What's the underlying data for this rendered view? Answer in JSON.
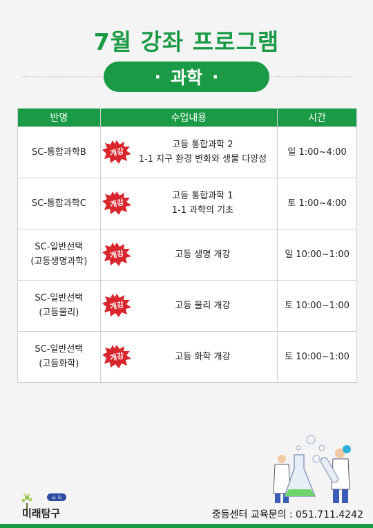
{
  "header": {
    "title": "7월 강좌 프로그램",
    "subject_dot_left": "·",
    "subject": "과학",
    "subject_dot_right": "·"
  },
  "table": {
    "headers": [
      "반명",
      "수업내용",
      "시간"
    ],
    "badge_text": "개강",
    "rows": [
      {
        "class_line1": "SC-통합과학B",
        "class_line2": "",
        "content_line1": "고등 통합과학 2",
        "content_line2": "1-1 지구 환경 변화와 생물 다양성",
        "time": "일 1:00~4:00"
      },
      {
        "class_line1": "SC-통합과학C",
        "class_line2": "",
        "content_line1": "고등 통합과학 1",
        "content_line2": "1-1 과학의 기초",
        "time": "토 1:00~4:00"
      },
      {
        "class_line1": "SC-일반선택",
        "class_line2": "(고등생명과학)",
        "content_line1": "고등 생명 개강",
        "content_line2": "",
        "time": "일 10:00~1:00"
      },
      {
        "class_line1": "SC-일반선택",
        "class_line2": "(고등물리)",
        "content_line1": "고등 물리 개강",
        "content_line2": "",
        "time": "토 10:00~1:00"
      },
      {
        "class_line1": "SC-일반선택",
        "class_line2": "(고등화학)",
        "content_line1": "고등 화학 개강",
        "content_line2": "",
        "time": "토 10:00~1:00"
      }
    ]
  },
  "footer": {
    "logo_tag": "사 직",
    "logo_text": "미래탐구",
    "contact": "중등센터 교육문의 : 051.711.4242"
  },
  "colors": {
    "brand_green": "#1a9a44",
    "badge_red": "#d9262c"
  },
  "icons": {
    "badge": "starburst-badge",
    "logo": "tree-logo-icon",
    "illustration": "scientists-lab-illustration"
  }
}
